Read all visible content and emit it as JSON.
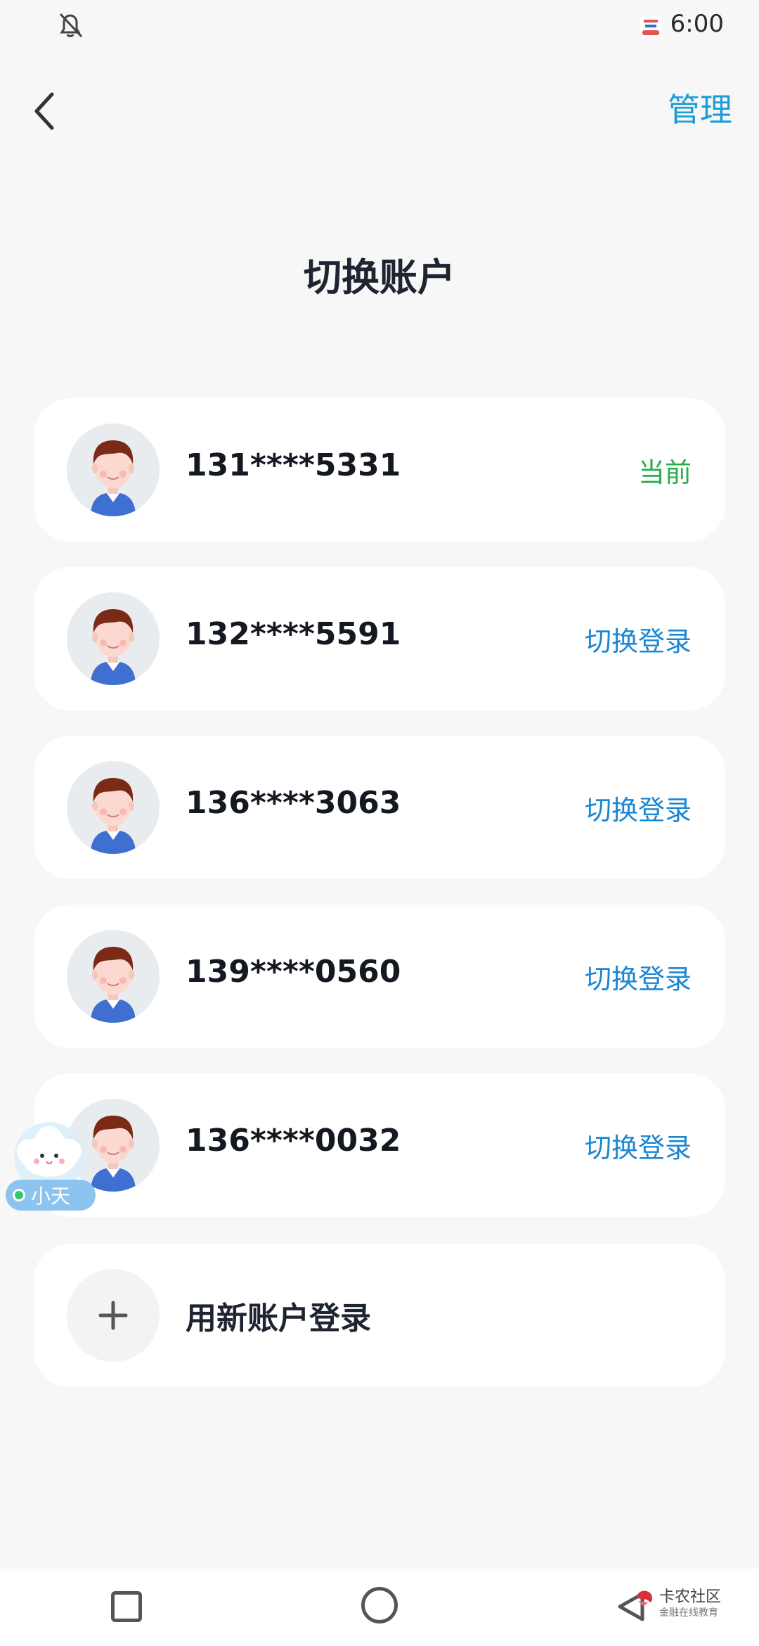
{
  "status_bar": {
    "time": "6:00",
    "icons": [
      "bell-off-icon",
      "app-badge-icon"
    ]
  },
  "header": {
    "manage_label": "管理",
    "back_icon": "chevron-left-icon"
  },
  "page": {
    "title": "切换账户"
  },
  "accounts": [
    {
      "phone": "131****5331",
      "action": "当前",
      "is_current": true
    },
    {
      "phone": "132****5591",
      "action": "切换登录",
      "is_current": false
    },
    {
      "phone": "136****3063",
      "action": "切换登录",
      "is_current": false
    },
    {
      "phone": "139****0560",
      "action": "切换登录",
      "is_current": false
    },
    {
      "phone": "136****0032",
      "action": "切换登录",
      "is_current": false
    }
  ],
  "add_account": {
    "label": "用新账户登录",
    "icon": "plus-icon"
  },
  "assistant": {
    "label": "小天"
  },
  "nav": {
    "icons": [
      "recent-apps-icon",
      "home-icon",
      "back-triangle-icon"
    ]
  },
  "watermark": {
    "title": "卡农社区",
    "subtitle": "金融在线教育"
  },
  "colors": {
    "accent": "#1b9ed6",
    "current": "#27b04a",
    "switch": "#1b86d3",
    "background": "#f7f7f8"
  }
}
